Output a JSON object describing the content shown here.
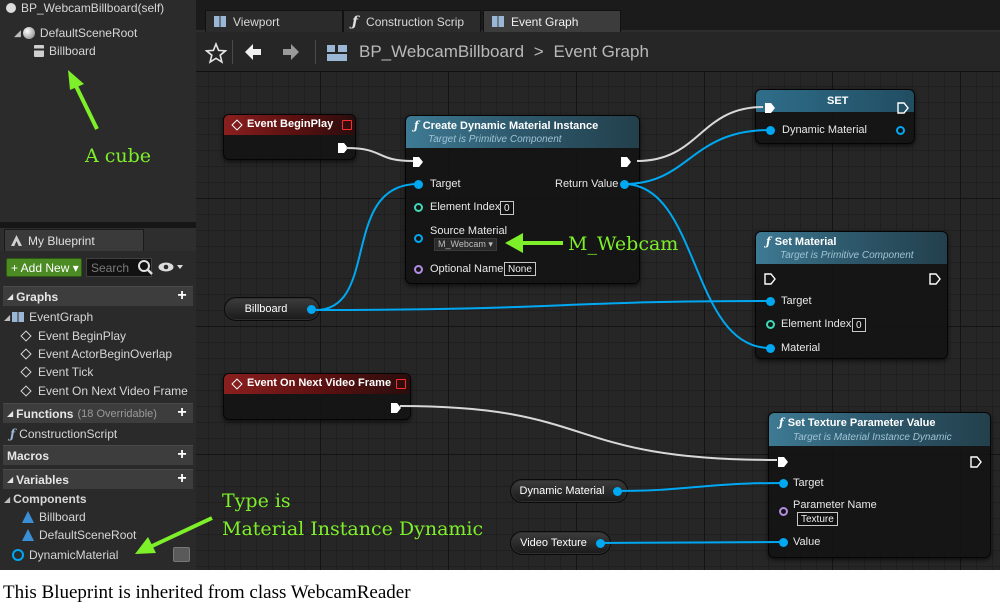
{
  "components_tree": {
    "root_label": "BP_WebcamBillboard(self)",
    "default_scene_root": "DefaultSceneRoot",
    "billboard": "Billboard"
  },
  "tabs": [
    {
      "label": "Viewport",
      "icon": "viewport-icon"
    },
    {
      "label": "Construction Scrip",
      "icon": "function-icon"
    },
    {
      "label": "Event Graph",
      "icon": "event-graph-icon"
    }
  ],
  "breadcrumb": {
    "blueprint": "BP_WebcamBillboard",
    "separator": ">",
    "graph": "Event Graph"
  },
  "my_blueprint": {
    "tab_label": "My Blueprint",
    "add_new_label": "+ Add New ▾",
    "search_placeholder": "Search",
    "graphs": {
      "header": "Graphs",
      "event_graph": "EventGraph",
      "items": [
        "Event BeginPlay",
        "Event ActorBeginOverlap",
        "Event Tick",
        "Event On Next Video Frame"
      ]
    },
    "functions": {
      "header": "Functions",
      "count": "(18 Overridable)",
      "items": [
        "ConstructionScript"
      ]
    },
    "macros": {
      "header": "Macros"
    },
    "variables": {
      "header": "Variables"
    },
    "components": {
      "header": "Components",
      "items": [
        "Billboard",
        "DefaultSceneRoot",
        "DynamicMaterial"
      ]
    }
  },
  "graph": {
    "event_begin_play": {
      "title": "Event BeginPlay"
    },
    "create_dmi": {
      "title": "Create Dynamic Material Instance",
      "subtitle": "Target is Primitive Component",
      "pins": {
        "target": "Target",
        "element_index": "Element Index",
        "element_index_value": "0",
        "source_material": "Source Material",
        "source_material_value": "M_Webcam ▾",
        "optional_name": "Optional Name",
        "optional_name_value": "None",
        "return_value": "Return Value"
      }
    },
    "set_node": {
      "title": "SET",
      "pin": "Dynamic Material"
    },
    "set_material": {
      "title": "Set Material",
      "subtitle": "Target is Primitive Component",
      "pins": {
        "target": "Target",
        "element_index": "Element Index",
        "element_index_value": "0",
        "material": "Material"
      }
    },
    "billboard_var": "Billboard",
    "event_next_frame": {
      "title": "Event On Next Video Frame"
    },
    "set_texture_param": {
      "title": "Set Texture Parameter Value",
      "subtitle": "Target is Material Instance Dynamic",
      "pins": {
        "target": "Target",
        "parameter_name": "Parameter Name",
        "parameter_name_value": "Texture",
        "value": "Value"
      }
    },
    "dynamic_material_var": "Dynamic Material",
    "video_texture_var": "Video Texture"
  },
  "annotations": {
    "a_cube": "A cube",
    "m_webcam": "M_Webcam",
    "type_is_line1": "Type is",
    "type_is_line2": "Material Instance Dynamic"
  },
  "caption": "This Blueprint is inherited from class WebcamReader",
  "colors": {
    "annotation_green": "#7ef02a",
    "object_pin_blue": "#00a8f2",
    "add_new_green": "#4c8b24",
    "event_red": "#8b1f1f",
    "function_blue": "#3e7a94"
  }
}
